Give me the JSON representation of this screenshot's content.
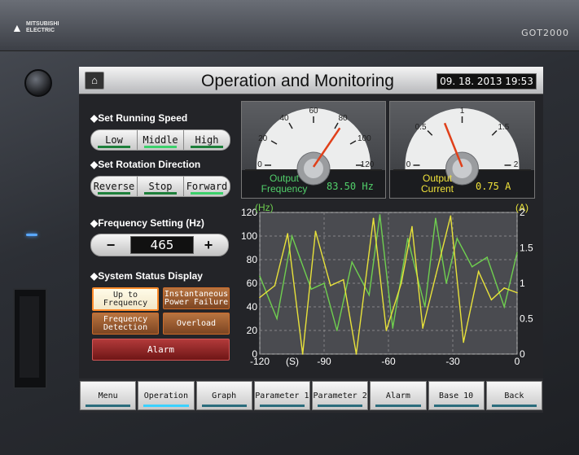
{
  "device": {
    "brand_line1": "MITSUBISHI",
    "brand_line2": "ELECTRIC",
    "model": "GOT2000"
  },
  "header": {
    "title": "Operation and Monitoring",
    "datetime": "09. 18. 2013 19:53",
    "home_icon": "home-icon"
  },
  "running_speed": {
    "title": "◆Set Running Speed",
    "options": [
      "Low",
      "Middle",
      "High"
    ],
    "selected": "Middle"
  },
  "rotation": {
    "title": "◆Set Rotation Direction",
    "options": [
      "Reverse",
      "Stop",
      "Forward"
    ],
    "selected": "Forward"
  },
  "frequency_setting": {
    "title": "◆Frequency Setting (Hz)",
    "minus": "−",
    "plus": "+",
    "value": "465"
  },
  "status": {
    "title": "◆System Status Display",
    "up_to_frequency": "Up to\nFrequency",
    "instantaneous_power_failure": "Instantaneous\nPower Failure",
    "frequency_detection": "Frequency\nDetection",
    "overload": "Overload",
    "alarm": "Alarm"
  },
  "gauge_frequency": {
    "label": "Output\nFrequency",
    "value": "83.50 Hz",
    "reading": 83.5,
    "min": 0,
    "max": 120,
    "ticks": [
      "0",
      "20",
      "40",
      "60",
      "80",
      "100",
      "120"
    ],
    "label_color": "#52d06b"
  },
  "gauge_current": {
    "label": "Output\nCurrent",
    "value": "0.75 A",
    "reading": 0.75,
    "min": 0,
    "max": 2,
    "ticks": [
      "0",
      "0.5",
      "1",
      "1.5",
      "2"
    ],
    "label_color": "#f0e23a"
  },
  "chart_data": {
    "type": "line",
    "left_unit": "(Hz)",
    "right_unit": "(A)",
    "x_unit": "(S)",
    "x_ticks": [
      "-120",
      "-90",
      "-60",
      "-30",
      "0"
    ],
    "y_left_ticks": [
      "0",
      "20",
      "40",
      "60",
      "80",
      "100",
      "120"
    ],
    "y_right_ticks": [
      "0",
      "0.5",
      "1",
      "1.5",
      "2"
    ],
    "xlim": [
      -120,
      0
    ],
    "ylim_left": [
      0,
      120
    ],
    "ylim_right": [
      0,
      2
    ],
    "grid": true,
    "series": [
      {
        "color": "#6fcf4f",
        "axis": "left",
        "x": [
          -120,
          -112,
          -105,
          -96,
          -90,
          -84,
          -77,
          -69,
          -64,
          -58,
          -51,
          -43,
          -38,
          -33,
          -28,
          -21,
          -14,
          -6,
          0
        ],
        "y": [
          66,
          30,
          100,
          55,
          60,
          20,
          78,
          50,
          118,
          22,
          98,
          40,
          115,
          60,
          98,
          74,
          82,
          40,
          86
        ]
      },
      {
        "color": "#e8e23a",
        "axis": "left",
        "x": [
          -120,
          -113,
          -107,
          -100,
          -94,
          -87,
          -81,
          -75,
          -67,
          -61,
          -54,
          -49,
          -44,
          -38,
          -31,
          -25,
          -18,
          -12,
          -6,
          0
        ],
        "y": [
          48,
          58,
          102,
          0,
          104,
          58,
          63,
          0,
          115,
          20,
          60,
          108,
          22,
          66,
          117,
          10,
          70,
          46,
          56,
          52
        ]
      }
    ]
  },
  "nav": {
    "items": [
      "Menu",
      "Operation",
      "Graph",
      "Parameter 1",
      "Parameter 2",
      "Alarm",
      "Base 10",
      "Back"
    ],
    "active": "Operation"
  }
}
